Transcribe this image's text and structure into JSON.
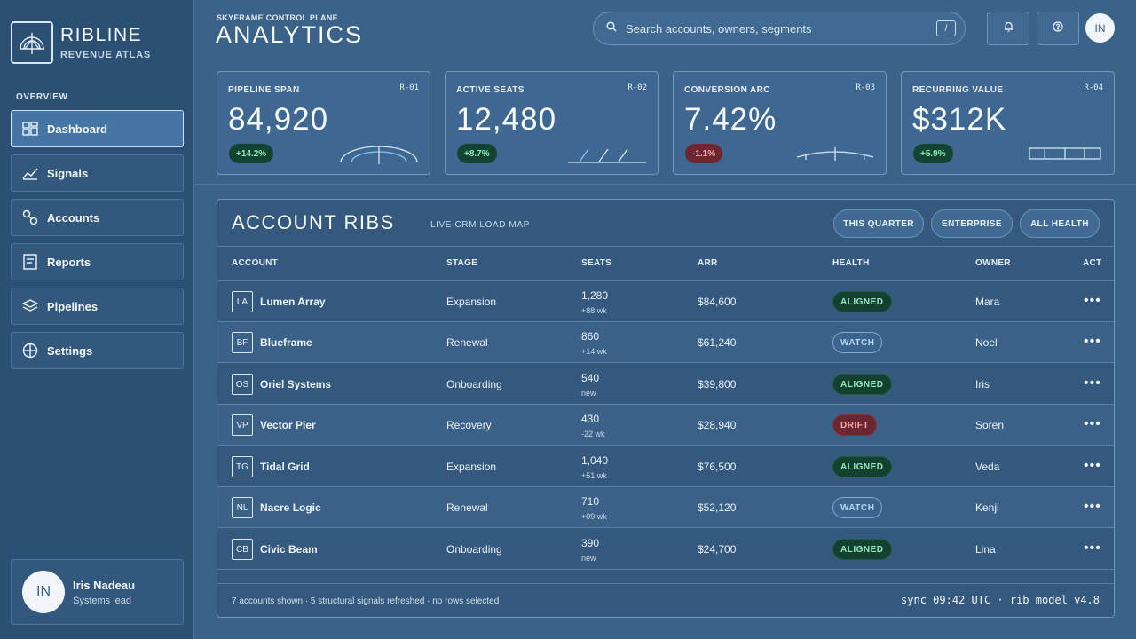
{
  "brand": {
    "name": "RIBLINE",
    "subtitle": "REVENUE ATLAS"
  },
  "nav": {
    "section": "OVERVIEW",
    "items": [
      {
        "label": "Dashboard",
        "icon": "dashboard-icon",
        "active": true
      },
      {
        "label": "Signals",
        "icon": "signals-icon"
      },
      {
        "label": "Accounts",
        "icon": "accounts-icon"
      },
      {
        "label": "Reports",
        "icon": "reports-icon"
      },
      {
        "label": "Pipelines",
        "icon": "pipelines-icon"
      },
      {
        "label": "Settings",
        "icon": "settings-icon"
      }
    ]
  },
  "user": {
    "initials": "IN",
    "name": "Iris Nadeau",
    "role": "Systems lead"
  },
  "header": {
    "eyebrow": "SKYFRAME CONTROL PLANE",
    "title": "ANALYTICS",
    "search_placeholder": "Search accounts, owners, segments",
    "search_shortcut": "/",
    "avatar_initials": "IN"
  },
  "kpis": [
    {
      "label": "PIPELINE SPAN",
      "code": "R-01",
      "value": "84,920",
      "delta": "+14.2%",
      "trend": "pos"
    },
    {
      "label": "ACTIVE SEATS",
      "code": "R-02",
      "value": "12,480",
      "delta": "+8.7%",
      "trend": "pos"
    },
    {
      "label": "CONVERSION ARC",
      "code": "R-03",
      "value": "7.42%",
      "delta": "-1.1%",
      "trend": "neg"
    },
    {
      "label": "RECURRING VALUE",
      "code": "R-04",
      "value": "$312K",
      "delta": "+5.9%",
      "trend": "pos"
    }
  ],
  "table": {
    "title": "ACCOUNT RIBS",
    "subtitle": "LIVE CRM LOAD MAP",
    "filters": [
      "THIS QUARTER",
      "ENTERPRISE",
      "ALL HEALTH"
    ],
    "columns": [
      "ACCOUNT",
      "STAGE",
      "SEATS",
      "ARR",
      "HEALTH",
      "OWNER",
      "ACT"
    ],
    "rows": [
      {
        "initials": "LA",
        "name": "Lumen Array",
        "stage": "Expansion",
        "seats": "1,280",
        "seats_sub": "+88 wk",
        "arr": "$84,600",
        "health": "ALIGNED",
        "owner": "Mara"
      },
      {
        "initials": "BF",
        "name": "Blueframe",
        "stage": "Renewal",
        "seats": "860",
        "seats_sub": "+14 wk",
        "arr": "$61,240",
        "health": "WATCH",
        "owner": "Noel"
      },
      {
        "initials": "OS",
        "name": "Oriel Systems",
        "stage": "Onboarding",
        "seats": "540",
        "seats_sub": "new",
        "arr": "$39,800",
        "health": "ALIGNED",
        "owner": "Iris"
      },
      {
        "initials": "VP",
        "name": "Vector Pier",
        "stage": "Recovery",
        "seats": "430",
        "seats_sub": "-22 wk",
        "arr": "$28,940",
        "health": "DRIFT",
        "owner": "Soren"
      },
      {
        "initials": "TG",
        "name": "Tidal Grid",
        "stage": "Expansion",
        "seats": "1,040",
        "seats_sub": "+51 wk",
        "arr": "$76,500",
        "health": "ALIGNED",
        "owner": "Veda"
      },
      {
        "initials": "NL",
        "name": "Nacre Logic",
        "stage": "Renewal",
        "seats": "710",
        "seats_sub": "+09 wk",
        "arr": "$52,120",
        "health": "WATCH",
        "owner": "Kenji"
      },
      {
        "initials": "CB",
        "name": "Civic Beam",
        "stage": "Onboarding",
        "seats": "390",
        "seats_sub": "new",
        "arr": "$24,700",
        "health": "ALIGNED",
        "owner": "Lina"
      }
    ],
    "row_action": "•••",
    "footer_left": "7 accounts shown · 5 structural signals refreshed · no rows selected",
    "footer_right": "sync 09:42 UTC · rib model v4.8"
  },
  "colors": {
    "background": "#3b6289",
    "sidebar": "#2c5074",
    "accent": "#4475a5",
    "positive": "#8fe6bb",
    "negative": "#f6a7ad"
  }
}
